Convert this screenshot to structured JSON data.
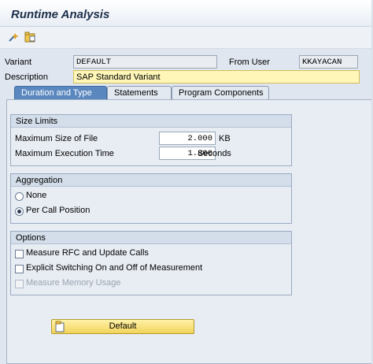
{
  "window": {
    "title": "Runtime Analysis"
  },
  "toolbar": {
    "icons": [
      "execute-with-variant-icon",
      "open-folder-icon"
    ]
  },
  "header": {
    "variant_label": "Variant",
    "variant_value": "DEFAULT",
    "from_user_label": "From User",
    "from_user_value": "KKAYACAN",
    "description_label": "Description",
    "description_value": "SAP Standard Variant"
  },
  "tabs": [
    {
      "label": "Duration and Type",
      "active": true
    },
    {
      "label": "Statements",
      "active": false
    },
    {
      "label": "Program Components",
      "active": false
    }
  ],
  "size_limits": {
    "title": "Size Limits",
    "max_file_label": "Maximum Size of File",
    "max_file_value": "2.000",
    "max_file_unit": "KB",
    "max_time_label": "Maximum Execution Time",
    "max_time_value": "1.800",
    "max_time_unit": "Seconds"
  },
  "aggregation": {
    "title": "Aggregation",
    "options": [
      {
        "label": "None",
        "selected": false
      },
      {
        "label": "Per Call Position",
        "selected": true
      }
    ]
  },
  "options": {
    "title": "Options",
    "items": [
      {
        "label": "Measure RFC and Update Calls",
        "checked": false,
        "enabled": true
      },
      {
        "label": "Explicit Switching On and Off of Measurement",
        "checked": false,
        "enabled": true
      },
      {
        "label": "Measure Memory Usage",
        "checked": false,
        "enabled": false
      }
    ]
  },
  "default_button": {
    "label": "Default"
  },
  "colors": {
    "active_tab": "#5a87be",
    "required_field": "#fff6b8",
    "button": "#f2d35b"
  }
}
